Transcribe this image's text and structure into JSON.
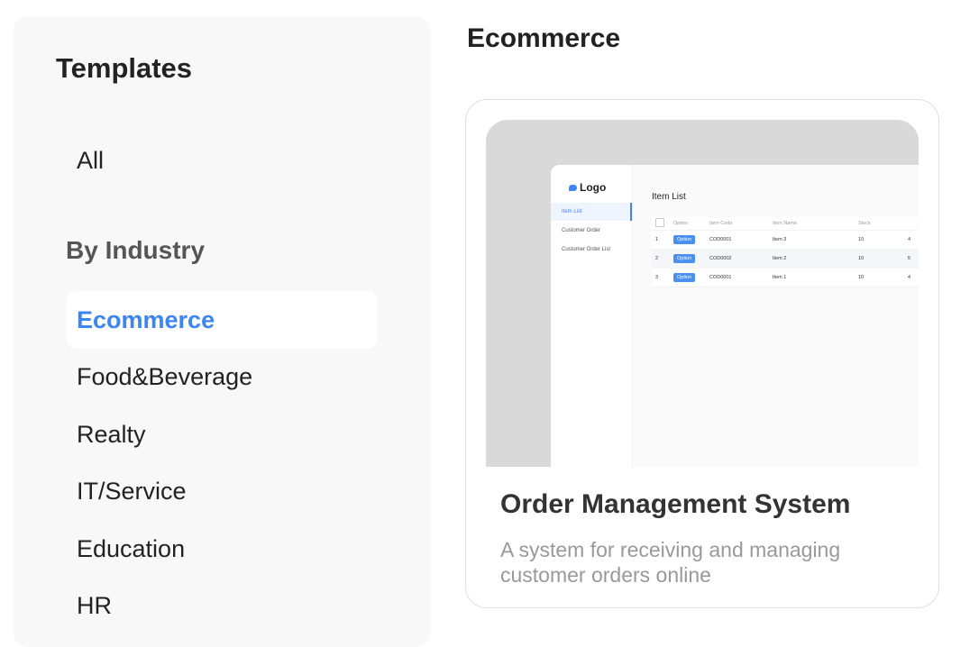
{
  "sidebar": {
    "title": "Templates",
    "all_label": "All",
    "section_label": "By Industry",
    "items": [
      {
        "label": "Ecommerce",
        "active": true
      },
      {
        "label": "Food&Beverage"
      },
      {
        "label": "Realty"
      },
      {
        "label": "IT/Service"
      },
      {
        "label": "Education"
      },
      {
        "label": "HR"
      }
    ]
  },
  "main": {
    "title": "Ecommerce",
    "card": {
      "title": "Order Management System",
      "description": "A system for receiving and managing customer orders online",
      "preview": {
        "logo": "Logo",
        "nav": [
          "Item List",
          "Customer Order",
          "Customer Order List"
        ],
        "page_title": "Item List",
        "columns": [
          "",
          "Option",
          "Item Code",
          "Item Name",
          "Stock",
          ""
        ],
        "rows": [
          {
            "no": "1",
            "button": "Option",
            "code": "COD0001",
            "name": "Item 3",
            "stock": "10",
            "extra": "4"
          },
          {
            "no": "2",
            "button": "Option",
            "code": "COD0002",
            "name": "Item 2",
            "stock": "10",
            "extra": "5"
          },
          {
            "no": "3",
            "button": "Option",
            "code": "COD0001",
            "name": "Item 1",
            "stock": "10",
            "extra": "4"
          }
        ]
      }
    }
  },
  "colors": {
    "accent": "#3d84f5",
    "sidebar_bg": "#f8f8f8",
    "preview_bg": "#d9d9d9"
  }
}
